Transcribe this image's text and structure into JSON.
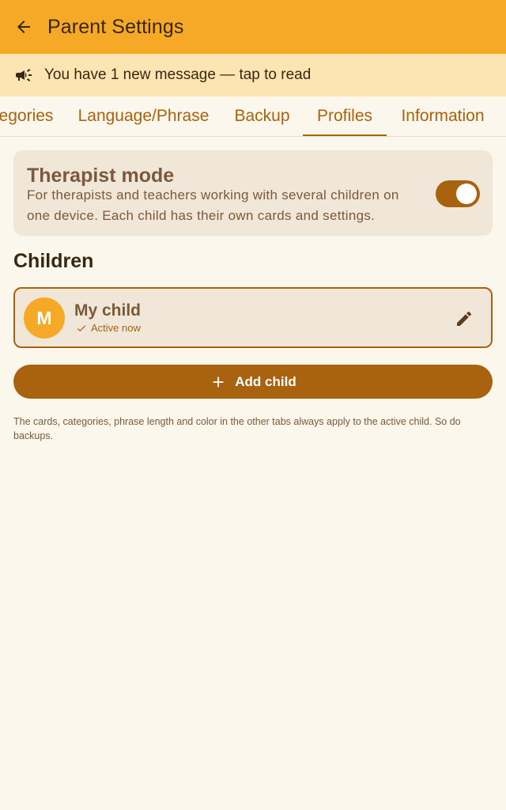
{
  "app_bar": {
    "title": "Parent Settings",
    "back_icon": "arrow-back-icon"
  },
  "banner": {
    "icon": "megaphone-icon",
    "text": "You have 1 new message — tap to read"
  },
  "tabs": [
    {
      "label": "egories",
      "active": false
    },
    {
      "label": "Language/Phrase",
      "active": false
    },
    {
      "label": "Backup",
      "active": false
    },
    {
      "label": "Profiles",
      "active": true
    },
    {
      "label": "Information",
      "active": false
    }
  ],
  "therapist_mode": {
    "title": "Therapist mode",
    "description": "For therapists and teachers working with several children on one device. Each child has their own cards and settings.",
    "enabled": true
  },
  "children_section": {
    "title": "Children",
    "children": [
      {
        "initial": "M",
        "name": "My child",
        "status": "Active now"
      }
    ]
  },
  "add_child_button": {
    "label": "Add child"
  },
  "footnote": "The cards, categories, phrase length and color in the other tabs always apply to the active child. So do backups.",
  "colors": {
    "app_bar": "#F5A927",
    "banner": "#FCE4B3",
    "accent": "#A9620D",
    "background": "#FCF7EC",
    "card": "#F0E7D8",
    "text_dark": "#3A2711",
    "text_muted": "#7B593A"
  }
}
